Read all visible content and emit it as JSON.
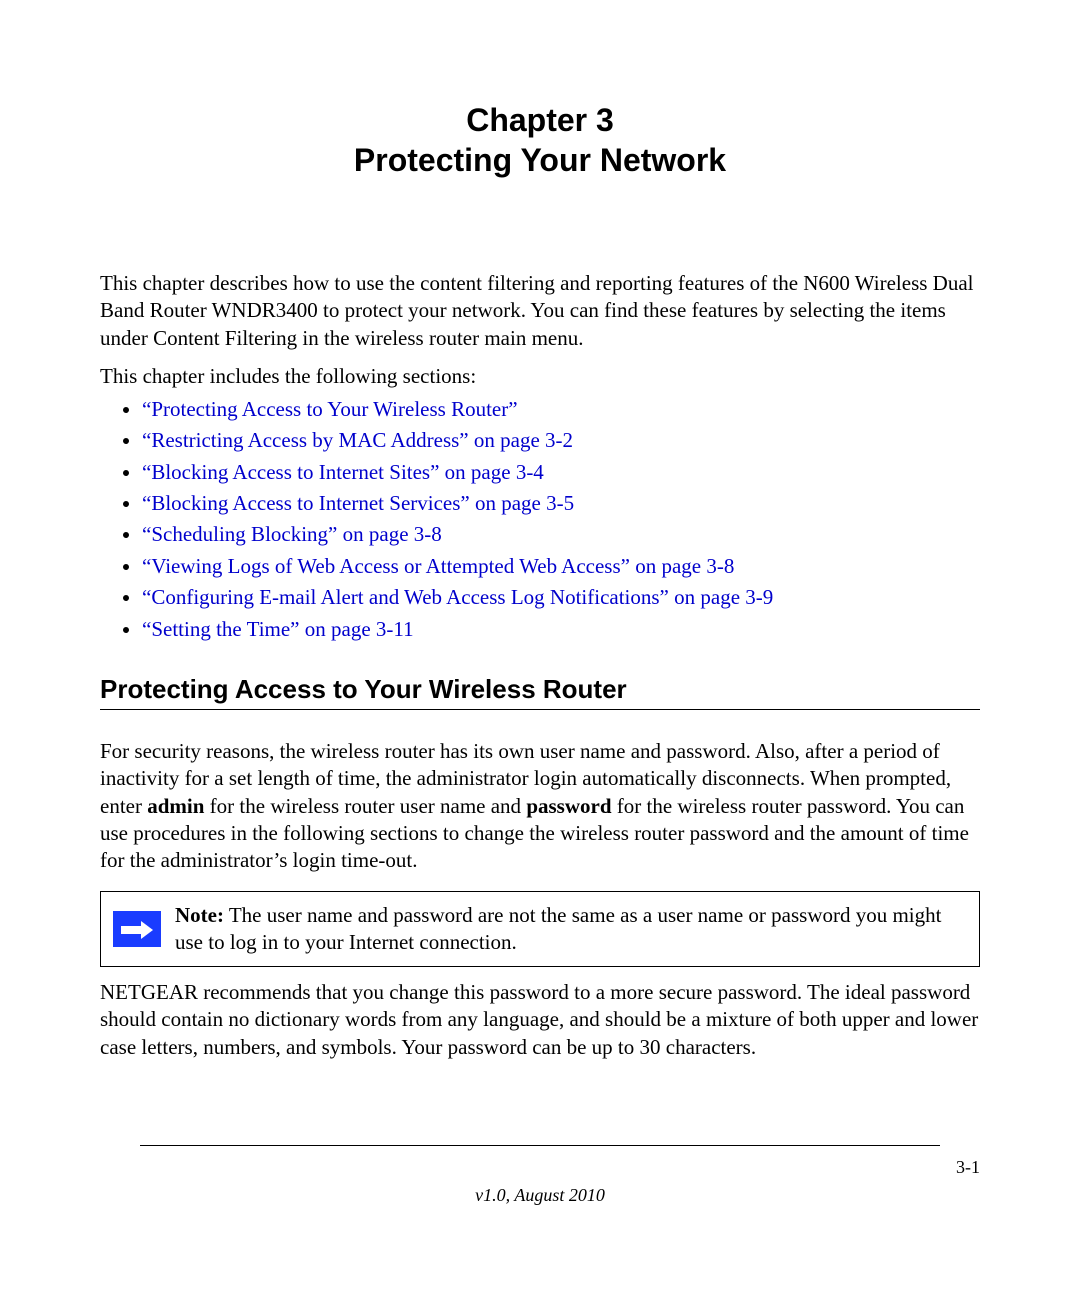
{
  "chapter": {
    "line1": "Chapter 3",
    "line2": "Protecting Your Network"
  },
  "intro_paragraph": "This chapter describes how to use the content filtering and reporting features of the N600 Wireless Dual Band Router WNDR3400 to protect your network. You can find these features by selecting the items under Content Filtering in the wireless router main menu.",
  "sections_lead": "This chapter includes the following sections:",
  "toc": [
    {
      "link": "“Protecting Access to Your Wireless Router”",
      "suffix": ""
    },
    {
      "link": "“Restricting Access by MAC Address” on page 3-2",
      "suffix": ""
    },
    {
      "link": "“Blocking Access to Internet Sites” on page 3-4",
      "suffix": ""
    },
    {
      "link": "“Blocking Access to Internet Services” on page 3-5",
      "suffix": ""
    },
    {
      "link": "“Scheduling Blocking” on page 3-8",
      "suffix": ""
    },
    {
      "link": "“Viewing Logs of Web Access or Attempted Web Access” on page 3-8",
      "suffix": ""
    },
    {
      "link": "“Configuring E-mail Alert and Web Access Log Notifications” on page 3-9",
      "suffix": ""
    },
    {
      "link": "“Setting the Time” on page 3-11",
      "suffix": ""
    }
  ],
  "section_heading": "Protecting Access to Your Wireless Router",
  "body1": {
    "pre": "For security reasons, the wireless router has its own user name and password. Also, after a period of inactivity for a set length of time, the administrator login automatically disconnects. When prompted, enter ",
    "b1": "admin",
    "mid": " for the wireless router user name and ",
    "b2": "password",
    "post": " for the wireless router password. You can use procedures in the following sections to change the wireless router password and the amount of time for the administrator’s login time-out."
  },
  "note": {
    "label": "Note:",
    "text": " The user name and password are not the same as a user name or password you might use to log in to your Internet connection."
  },
  "body2": "NETGEAR recommends that you change this password to a more secure password. The ideal password should contain no dictionary words from any language, and should be a mixture of both upper and lower case letters, numbers, and symbols. Your password can be up to 30 characters.",
  "footer": {
    "page_number": "3-1",
    "version": "v1.0, August 2010"
  }
}
